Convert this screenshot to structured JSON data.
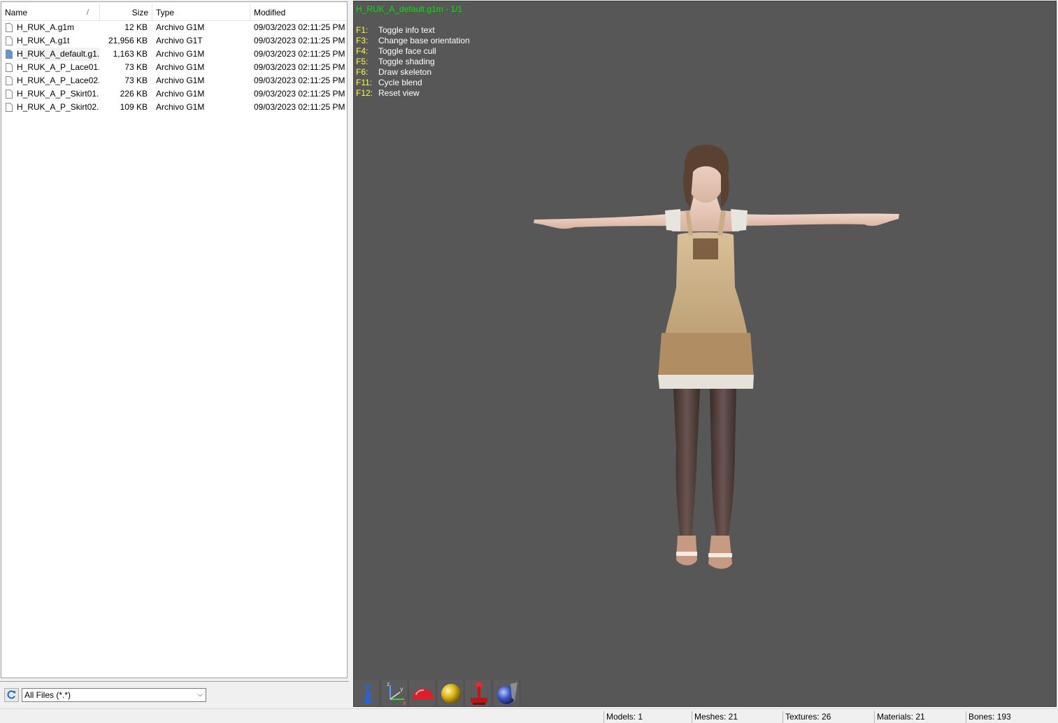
{
  "file_browser": {
    "columns": {
      "name": "Name",
      "size": "Size",
      "type": "Type",
      "modified": "Modified"
    },
    "sort_indicator": "/",
    "files": [
      {
        "name": "H_RUK_A.g1m",
        "size": "12 KB",
        "type": "Archivo G1M",
        "modified": "09/03/2023 02:11:25 PM",
        "selected": false
      },
      {
        "name": "H_RUK_A.g1t",
        "size": "21,956 KB",
        "type": "Archivo G1T",
        "modified": "09/03/2023 02:11:25 PM",
        "selected": false
      },
      {
        "name": "H_RUK_A_default.g1...",
        "size": "1,163 KB",
        "type": "Archivo G1M",
        "modified": "09/03/2023 02:11:25 PM",
        "selected": true
      },
      {
        "name": "H_RUK_A_P_Lace01....",
        "size": "73 KB",
        "type": "Archivo G1M",
        "modified": "09/03/2023 02:11:25 PM",
        "selected": false
      },
      {
        "name": "H_RUK_A_P_Lace02....",
        "size": "73 KB",
        "type": "Archivo G1M",
        "modified": "09/03/2023 02:11:25 PM",
        "selected": false
      },
      {
        "name": "H_RUK_A_P_Skirt01....",
        "size": "226 KB",
        "type": "Archivo G1M",
        "modified": "09/03/2023 02:11:25 PM",
        "selected": false
      },
      {
        "name": "H_RUK_A_P_Skirt02....",
        "size": "109 KB",
        "type": "Archivo G1M",
        "modified": "09/03/2023 02:11:25 PM",
        "selected": false
      }
    ],
    "filter": {
      "value": "All Files (*.*)"
    }
  },
  "viewport": {
    "title": "H_RUK_A_default.g1m - 1/1",
    "help": [
      {
        "key": "F1:",
        "text": "Toggle info text"
      },
      {
        "key": "F3:",
        "text": "Change base orientation"
      },
      {
        "key": "F4:",
        "text": "Toggle face cull"
      },
      {
        "key": "F5:",
        "text": "Toggle shading"
      },
      {
        "key": "F6:",
        "text": "Draw skeleton"
      },
      {
        "key": "F11:",
        "text": "Cycle blend"
      },
      {
        "key": "F12:",
        "text": "Reset view"
      }
    ],
    "background_color": "#575757",
    "toolbar_icons": [
      "info-icon",
      "axes-icon",
      "dome-icon",
      "sphere-icon",
      "joystick-icon",
      "material-ball-icon"
    ]
  },
  "status": {
    "models": "Models: 1",
    "meshes": "Meshes: 21",
    "textures": "Textures: 26",
    "materials": "Materials: 21",
    "bones": "Bones: 193"
  }
}
